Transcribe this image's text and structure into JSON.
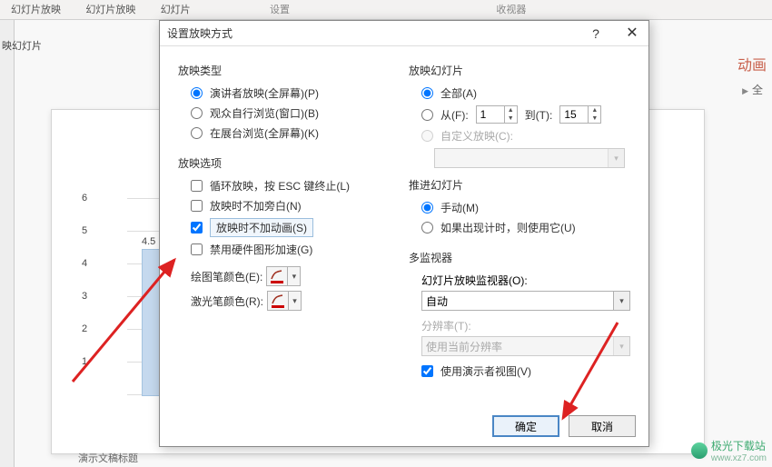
{
  "bg": {
    "ribbon": [
      "幻灯片放映",
      "幻灯片放映",
      "幻灯片"
    ],
    "ribbon_group1": "设置",
    "ribbon_group2": "收视器",
    "left_label": "映幻灯片",
    "right_title": "动画",
    "right_sub": "全",
    "footer_label": "演示文稿标题"
  },
  "chart_data": {
    "type": "bar",
    "categories": [
      ""
    ],
    "values": [
      4.5
    ],
    "title": "",
    "xlabel": "",
    "ylabel": "",
    "ylim": [
      0,
      6
    ],
    "y_ticks": [
      1.0,
      2.0,
      3.0,
      4.0,
      5.0,
      6.0
    ],
    "data_label": "4.5"
  },
  "dialog": {
    "title": "设置放映方式",
    "help": "?",
    "close": "✕",
    "left": {
      "g1": "放映类型",
      "type_presenter": "演讲者放映(全屏幕)(P)",
      "type_browse": "观众自行浏览(窗口)(B)",
      "type_kiosk": "在展台浏览(全屏幕)(K)",
      "g2": "放映选项",
      "opt_loop": "循环放映，按 ESC 键终止(L)",
      "opt_no_narr": "放映时不加旁白(N)",
      "opt_no_anim": "放映时不加动画(S)",
      "opt_hw": "禁用硬件图形加速(G)",
      "pen_color": "绘图笔颜色(E):",
      "laser_color": "激光笔颜色(R):"
    },
    "right": {
      "g1": "放映幻灯片",
      "slide_all": "全部(A)",
      "slide_from": "从(F):",
      "from_val": "1",
      "slide_to": "到(T):",
      "to_val": "15",
      "slide_custom": "自定义放映(C):",
      "custom_val": "",
      "g2": "推进幻灯片",
      "adv_manual": "手动(M)",
      "adv_timing": "如果出现计时，则使用它(U)",
      "g3": "多监视器",
      "monitor_label": "幻灯片放映监视器(O):",
      "monitor_val": "自动",
      "res_label": "分辨率(T):",
      "res_val": "使用当前分辨率",
      "use_presenter": "使用演示者视图(V)"
    },
    "ok": "确定",
    "cancel": "取消"
  },
  "watermark": {
    "name": "极光下载站",
    "url": "www.xz7.com"
  }
}
